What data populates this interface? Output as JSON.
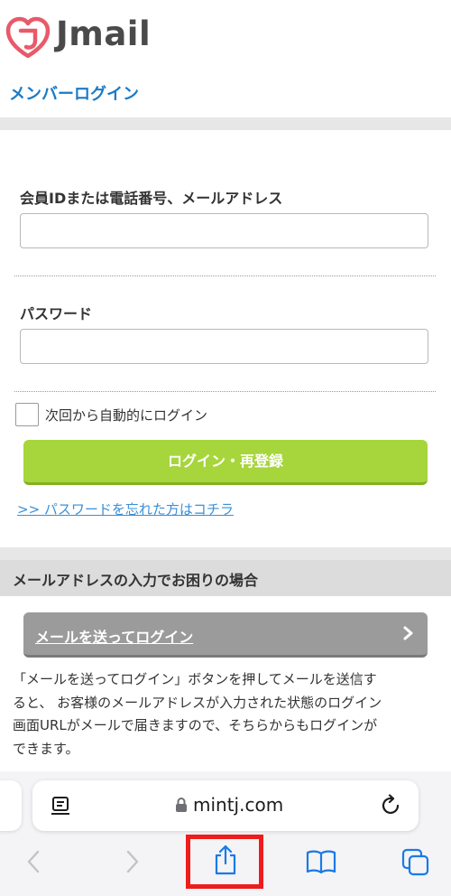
{
  "header": {
    "brand": "Jmail",
    "colors": {
      "logo_mark": "#e85a6a",
      "brand_text": "#4a4a4a"
    }
  },
  "page_title": "メンバーログイン",
  "login_form": {
    "id_label": "会員IDまたは電話番号、メールアドレス",
    "id_value": "",
    "password_label": "パスワード",
    "password_value": "",
    "auto_login_label": "次回から自動的にログイン",
    "auto_login_checked": false,
    "login_button": "ログイン・再登録",
    "forgot_link": ">> パスワードを忘れた方はコチラ",
    "colors": {
      "login_button": "#a6d63c",
      "link": "#3a8fd6",
      "title": "#1a7ac8"
    }
  },
  "email_help": {
    "title": "メールアドレスの入力でお困りの場合",
    "button": "メールを送ってログイン",
    "description_lines": [
      "「メールを送ってログイン」ボタンを押してメールを送信す",
      "ると、 お客様のメールアドレスが入力された状態のログイン",
      "画面URLがメールで届きますので、そちらからもログインが",
      "できます。"
    ]
  },
  "browser": {
    "url": "mintj.com",
    "icons": {
      "reader": "reader-mode-icon",
      "lock": "lock-icon",
      "reload": "reload-icon",
      "back": "back-chevron-icon",
      "forward": "forward-chevron-icon",
      "share": "share-icon",
      "bookmarks": "bookmarks-book-icon",
      "tabs": "tabs-overview-icon"
    },
    "highlight_color": "#ee1c1c"
  }
}
